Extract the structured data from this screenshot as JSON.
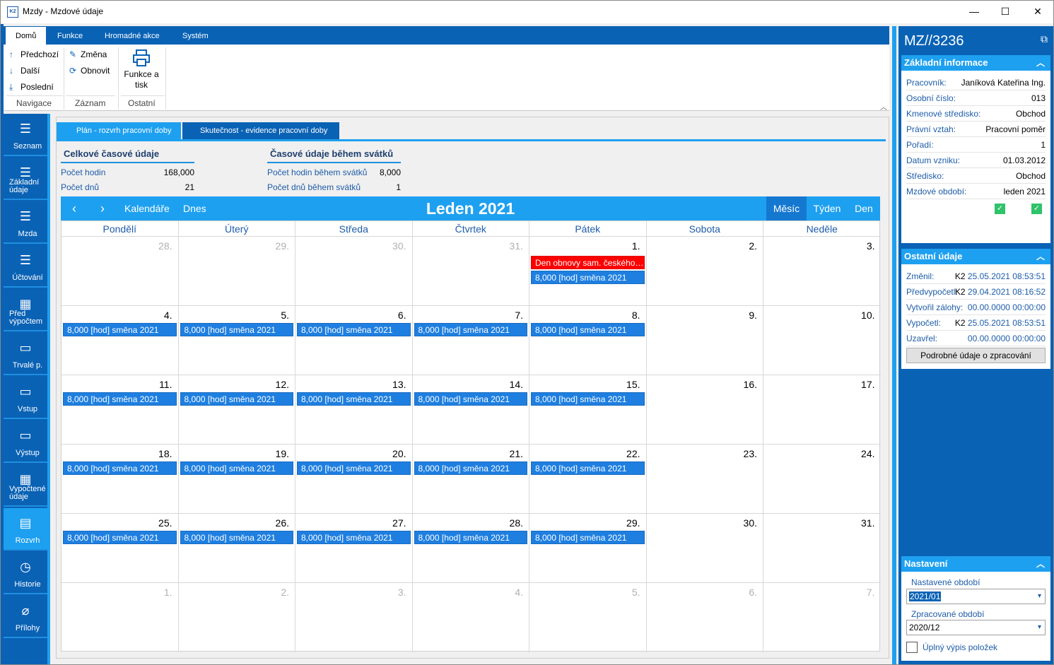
{
  "window": {
    "title": "Mzdy - Mzdové údaje",
    "app_icon": "K2",
    "minimize": "—",
    "maximize": "☐",
    "close": "✕"
  },
  "ribbon": {
    "tabs": [
      "Domů",
      "Funkce",
      "Hromadné akce",
      "Systém"
    ],
    "navigation": {
      "prev": "Předchozí",
      "next": "Další",
      "last": "Poslední",
      "group": "Navigace"
    },
    "record": {
      "change": "Změna",
      "refresh": "Obnovit",
      "group": "Záznam"
    },
    "other": {
      "print_line1": "Funkce a",
      "print_line2": "tisk",
      "group": "Ostatní"
    }
  },
  "sidenav": [
    {
      "label": "Seznam",
      "icon": "list-icon"
    },
    {
      "label": "Základní údaje",
      "icon": "list-icon"
    },
    {
      "label": "Mzda",
      "icon": "list-icon"
    },
    {
      "label": "Účtování",
      "icon": "list-icon"
    },
    {
      "label": "Před výpočtem",
      "icon": "calculator-icon"
    },
    {
      "label": "Trvalé p.",
      "icon": "archive-icon"
    },
    {
      "label": "Vstup",
      "icon": "archive-icon"
    },
    {
      "label": "Výstup",
      "icon": "archive-icon"
    },
    {
      "label": "Vypočtené údaje",
      "icon": "calculator-icon"
    },
    {
      "label": "Rozvrh",
      "icon": "calendar-icon"
    },
    {
      "label": "Historie",
      "icon": "clock-icon"
    },
    {
      "label": "Přílohy",
      "icon": "paperclip-icon"
    }
  ],
  "tabs": [
    "Plán - rozvrh pracovní doby",
    "Skutečnost - evidence pracovní doby"
  ],
  "summary": {
    "total_title": "Celkové časové údaje",
    "hours_label": "Počet hodin",
    "hours_value": "168,000",
    "days_label": "Počet dnů",
    "days_value": "21",
    "holiday_title": "Časové údaje během svátků",
    "holiday_hours_label": "Počet hodin během svátků",
    "holiday_hours_value": "8,000",
    "holiday_days_label": "Počet dnů během svátků",
    "holiday_days_value": "1"
  },
  "calendar": {
    "title": "Leden 2021",
    "calendars": "Kalendáře",
    "today": "Dnes",
    "modes": [
      "Měsíc",
      "Týden",
      "Den"
    ],
    "days": [
      "Pondělí",
      "Úterý",
      "Středa",
      "Čtvrtek",
      "Pátek",
      "Sobota",
      "Neděle"
    ],
    "weeks": [
      [
        {
          "n": "28.",
          "o": true
        },
        {
          "n": "29.",
          "o": true
        },
        {
          "n": "30.",
          "o": true
        },
        {
          "n": "31.",
          "o": true
        },
        {
          "n": "1.",
          "e": [
            "Den obnovy sam. českého státu",
            "8,000 [hod] směna 2021"
          ],
          "r": true
        },
        {
          "n": "2."
        },
        {
          "n": "3."
        }
      ],
      [
        {
          "n": "4.",
          "e": [
            "8,000 [hod] směna 2021"
          ]
        },
        {
          "n": "5.",
          "e": [
            "8,000 [hod] směna 2021"
          ]
        },
        {
          "n": "6.",
          "e": [
            "8,000 [hod] směna 2021"
          ]
        },
        {
          "n": "7.",
          "e": [
            "8,000 [hod] směna 2021"
          ]
        },
        {
          "n": "8.",
          "e": [
            "8,000 [hod] směna 2021"
          ]
        },
        {
          "n": "9."
        },
        {
          "n": "10."
        }
      ],
      [
        {
          "n": "11.",
          "e": [
            "8,000 [hod] směna 2021"
          ]
        },
        {
          "n": "12.",
          "e": [
            "8,000 [hod] směna 2021"
          ]
        },
        {
          "n": "13.",
          "e": [
            "8,000 [hod] směna 2021"
          ]
        },
        {
          "n": "14.",
          "e": [
            "8,000 [hod] směna 2021"
          ]
        },
        {
          "n": "15.",
          "e": [
            "8,000 [hod] směna 2021"
          ]
        },
        {
          "n": "16."
        },
        {
          "n": "17."
        }
      ],
      [
        {
          "n": "18.",
          "e": [
            "8,000 [hod] směna 2021"
          ]
        },
        {
          "n": "19.",
          "e": [
            "8,000 [hod] směna 2021"
          ]
        },
        {
          "n": "20.",
          "e": [
            "8,000 [hod] směna 2021"
          ]
        },
        {
          "n": "21.",
          "e": [
            "8,000 [hod] směna 2021"
          ]
        },
        {
          "n": "22.",
          "e": [
            "8,000 [hod] směna 2021"
          ]
        },
        {
          "n": "23."
        },
        {
          "n": "24."
        }
      ],
      [
        {
          "n": "25.",
          "e": [
            "8,000 [hod] směna 2021"
          ]
        },
        {
          "n": "26.",
          "e": [
            "8,000 [hod] směna 2021"
          ]
        },
        {
          "n": "27.",
          "e": [
            "8,000 [hod] směna 2021"
          ]
        },
        {
          "n": "28.",
          "e": [
            "8,000 [hod] směna 2021"
          ]
        },
        {
          "n": "29.",
          "e": [
            "8,000 [hod] směna 2021"
          ]
        },
        {
          "n": "30."
        },
        {
          "n": "31."
        }
      ],
      [
        {
          "n": "1.",
          "o": true
        },
        {
          "n": "2.",
          "o": true
        },
        {
          "n": "3.",
          "o": true
        },
        {
          "n": "4.",
          "o": true
        },
        {
          "n": "5.",
          "o": true
        },
        {
          "n": "6.",
          "o": true
        },
        {
          "n": "7.",
          "o": true
        }
      ]
    ]
  },
  "right": {
    "title": "MZ//3236",
    "basic_title": "Základní informace",
    "basic": [
      {
        "label": "Pracovník:",
        "value": "Janíková Kateřina Ing."
      },
      {
        "label": "Osobní číslo:",
        "value": "013"
      },
      {
        "label": "Kmenové středisko:",
        "value": "Obchod"
      },
      {
        "label": "Právní vztah:",
        "value": "Pracovní poměr"
      },
      {
        "label": "Pořadí:",
        "value": "1"
      },
      {
        "label": "Datum vzniku:",
        "value": "01.03.2012"
      },
      {
        "label": "Středisko:",
        "value": "Obchod"
      },
      {
        "label": "Mzdové období:",
        "value": "leden 2021"
      }
    ],
    "other_title": "Ostatní údaje",
    "other": [
      {
        "label": "Změnil:",
        "user": "K2",
        "date": "25.05.2021 08:53:51"
      },
      {
        "label": "Předvypočetl:",
        "user": "K2",
        "date": "29.04.2021 08:16:52"
      },
      {
        "label": "Vytvořil zálohy:",
        "user": "",
        "date": "00.00.0000 00:00:00"
      },
      {
        "label": "Vypočetl:",
        "user": "K2",
        "date": "25.05.2021 08:53:51"
      },
      {
        "label": "Uzavřel:",
        "user": "",
        "date": "00.00.0000 00:00:00"
      }
    ],
    "details_button": "Podrobné údaje o zpracování",
    "settings_title": "Nastavení",
    "set_period_label": "Nastavené období",
    "set_period_value": "2021/01",
    "proc_period_label": "Zpracované období",
    "proc_period_value": "2020/12",
    "full_list_label": "Úplný výpis položek"
  }
}
